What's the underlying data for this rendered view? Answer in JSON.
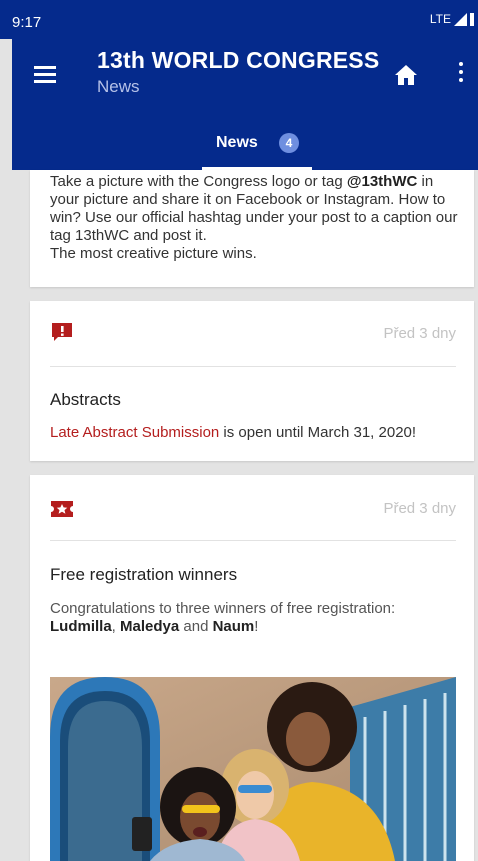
{
  "status_bar": {
    "time": "9:17",
    "network": "LTE"
  },
  "app_bar": {
    "title": "13th WORLD CONGRESS",
    "subtitle": "News",
    "menu_icon": "menu-icon",
    "home_icon": "home-icon",
    "more_icon": "more-vert-icon"
  },
  "tabs": [
    {
      "label": "News",
      "badge": "4"
    }
  ],
  "colors": {
    "primary": "#052a8c",
    "accent": "#b41e1e",
    "badge": "#6f8fe0"
  },
  "feed": [
    {
      "body_parts": [
        "Take a picture with the Congress logo or tag ",
        "@13thWC",
        " in your picture and share it on Facebook or Instagram. How to win? Use our official hashtag under your post to a caption our tag 13thWC and post it.",
        "The most creative picture wins."
      ]
    },
    {
      "icon": "alert-icon",
      "time": "Před 3 dny",
      "title": "Abstracts",
      "link_text": "Late Abstract Submission",
      "body": " is open until March 31, 2020!"
    },
    {
      "icon": "ticket-star-icon",
      "time": "Před 3 dny",
      "title": "Free registration winners",
      "body_intro": "Congratulations to three winners of free registration:",
      "winner_1": "Ludmilla",
      "sep_1": ", ",
      "winner_2": "Maledya",
      "sep_2": " and ",
      "winner_3": "Naum",
      "end": "!",
      "image": "photo-of-three-smiling-women"
    }
  ]
}
